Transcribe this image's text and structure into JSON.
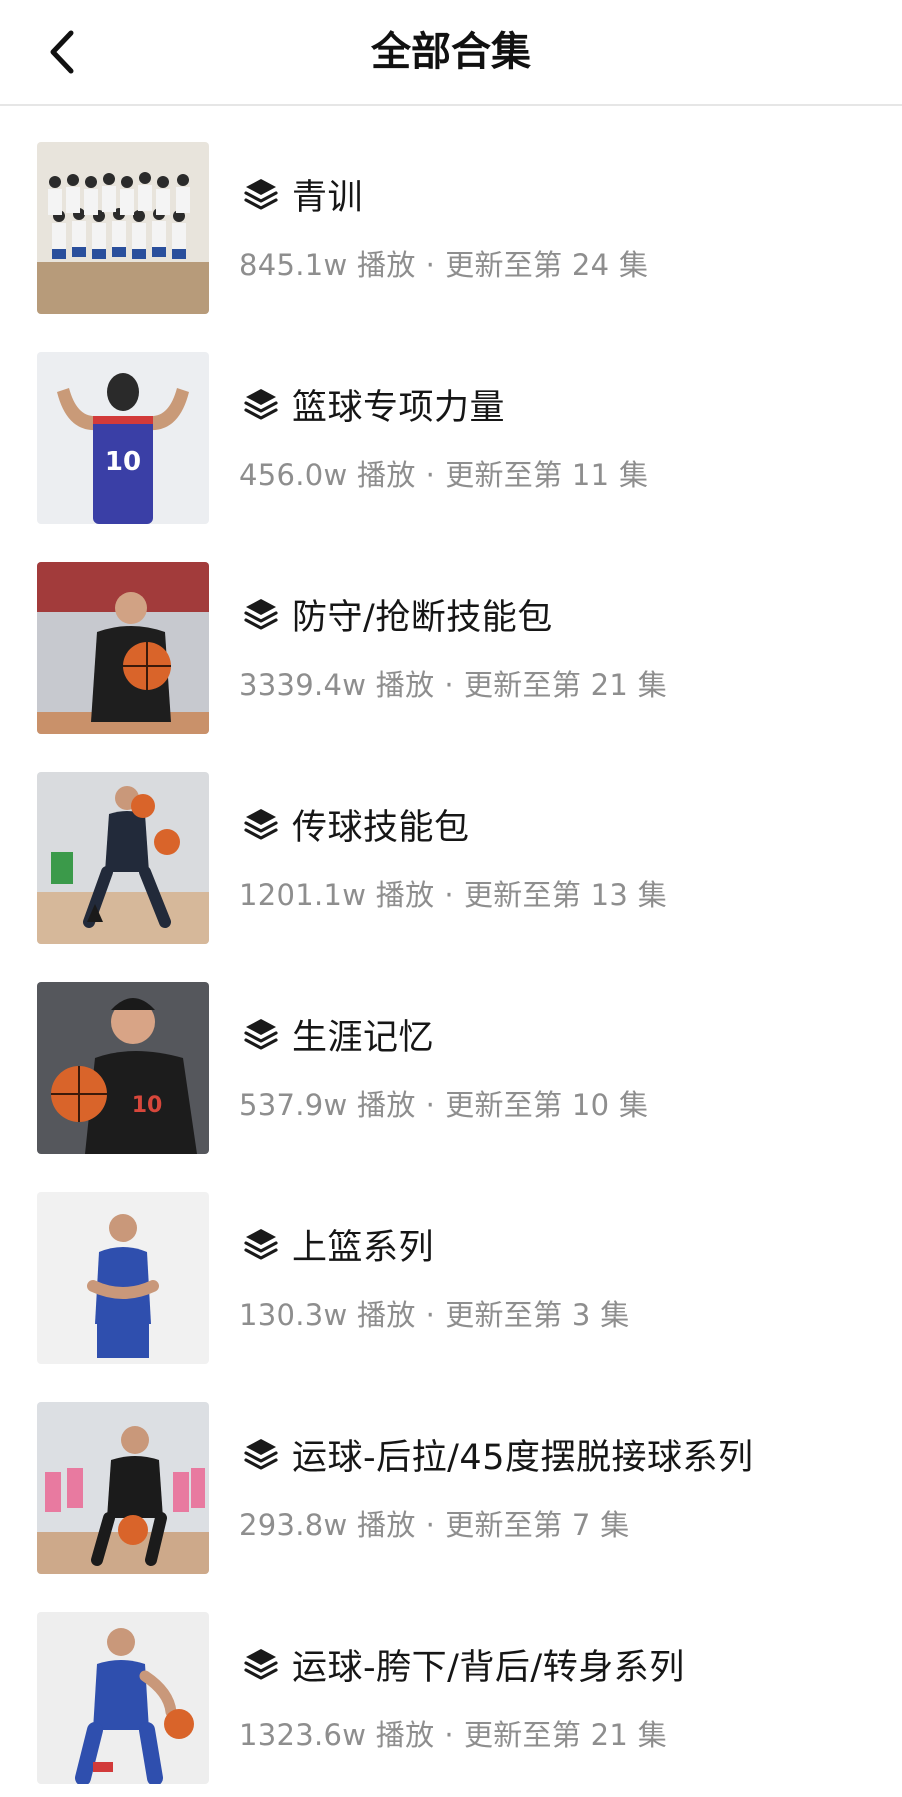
{
  "header": {
    "title": "全部合集",
    "back_icon": "chevron-left-icon"
  },
  "collection_icon": "layers-stack-icon",
  "collections": [
    {
      "title": "青训",
      "plays": "845.1w 播放",
      "separator": "·",
      "update": "更新至第 24 集"
    },
    {
      "title": "篮球专项力量",
      "plays": "456.0w 播放",
      "separator": "·",
      "update": "更新至第 11 集"
    },
    {
      "title": "防守/抢断技能包",
      "plays": "3339.4w 播放",
      "separator": "·",
      "update": "更新至第 21 集"
    },
    {
      "title": "传球技能包",
      "plays": "1201.1w 播放",
      "separator": "·",
      "update": "更新至第 13 集"
    },
    {
      "title": "生涯记忆",
      "plays": "537.9w 播放",
      "separator": "·",
      "update": "更新至第 10 集"
    },
    {
      "title": "上篮系列",
      "plays": "130.3w 播放",
      "separator": "·",
      "update": "更新至第 3 集"
    },
    {
      "title": "运球-后拉/45度摆脱接球系列",
      "plays": "293.8w 播放",
      "separator": "·",
      "update": "更新至第 7 集"
    },
    {
      "title": "运球-胯下/背后/转身系列",
      "plays": "1323.6w 播放",
      "separator": "·",
      "update": "更新至第 21 集"
    }
  ],
  "colors": {
    "title_text": "#161616",
    "meta_text": "#8e8e8e",
    "divider": "#e6e6e6"
  }
}
